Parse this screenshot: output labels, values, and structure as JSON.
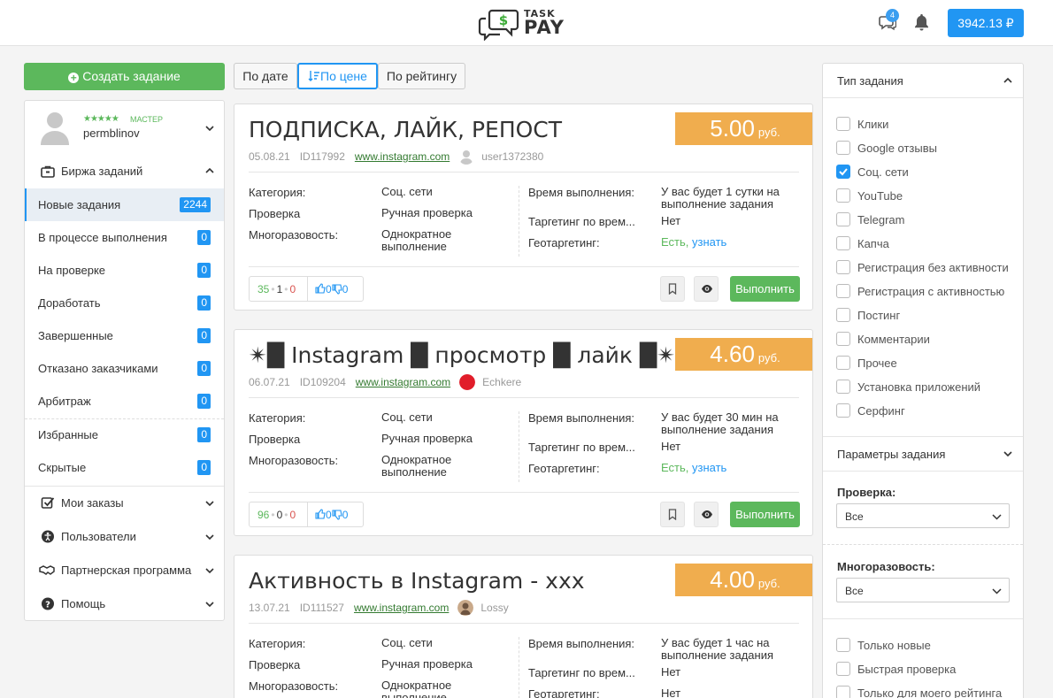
{
  "header": {
    "logo_top": "TASK",
    "logo_bottom": "PAY",
    "messages_count": "4",
    "balance": "3942.13 ₽"
  },
  "sidebar": {
    "create_button": "Создать задание",
    "profile": {
      "rank": "МАСТЕР",
      "username": "permblinov",
      "stars": "★★★★★"
    },
    "exchange_title": "Биржа заданий",
    "items": [
      {
        "label": "Новые задания",
        "count": "2244"
      },
      {
        "label": "В процессе выполнения",
        "count": "0"
      },
      {
        "label": "На проверке",
        "count": "0"
      },
      {
        "label": "Доработать",
        "count": "0"
      },
      {
        "label": "Завершенные",
        "count": "0"
      },
      {
        "label": "Отказано заказчиками",
        "count": "0"
      },
      {
        "label": "Арбитраж",
        "count": "0"
      },
      {
        "label": "Избранные",
        "count": "0"
      },
      {
        "label": "Скрытые",
        "count": "0"
      }
    ],
    "sections": [
      {
        "label": "Мои заказы"
      },
      {
        "label": "Пользователи"
      },
      {
        "label": "Партнерская программа"
      },
      {
        "label": "Помощь"
      }
    ]
  },
  "sort": {
    "by_date": "По дате",
    "by_price": "По цене",
    "by_rating": "По рейтингу"
  },
  "field_labels": {
    "category": "Категория:",
    "check": "Проверка",
    "reusability": "Многоразовость:",
    "time": "Время выполнения:",
    "targeting_time": "Таргетинг по врем...",
    "geo": "Геотаргетинг:",
    "do_button": "Выполнить"
  },
  "tasks": [
    {
      "title": "ПОДПИСКА, ЛАЙК, РЕПОСТ",
      "price": "5.00",
      "currency": "руб.",
      "date": "05.08.21",
      "id": "ID117992",
      "site": "www.instagram.com",
      "user": "user1372380",
      "category": "Соц. сети",
      "check": "Ручная проверка",
      "reusability": "Однократное выполнение",
      "time": "У вас будет 1 сутки на выполнение задания",
      "targeting_time": "Нет",
      "geo": "Есть,",
      "geo_link": "узнать",
      "stat_green": "35",
      "stat_mid": "1",
      "stat_red": "0",
      "likes": "0",
      "dislikes": "0"
    },
    {
      "title": "✴█ Instagram █ просмотр █ лайк █✴",
      "price": "4.60",
      "currency": "руб.",
      "date": "06.07.21",
      "id": "ID109204",
      "site": "www.instagram.com",
      "user": "Echkere",
      "category": "Соц. сети",
      "check": "Ручная проверка",
      "reusability": "Однократное выполнение",
      "time": "У вас будет 30 мин на выполнение задания",
      "targeting_time": "Нет",
      "geo": "Есть,",
      "geo_link": "узнать",
      "stat_green": "96",
      "stat_mid": "0",
      "stat_red": "0",
      "likes": "0",
      "dislikes": "0"
    },
    {
      "title": "Активность в Instagram - xxx",
      "price": "4.00",
      "currency": "руб.",
      "date": "13.07.21",
      "id": "ID111527",
      "site": "www.instagram.com",
      "user": "Lossy",
      "category": "Соц. сети",
      "check": "Ручная проверка",
      "reusability": "Однократное выполнение",
      "time": "У вас будет 1 час на выполнение задания",
      "targeting_time": "Нет",
      "geo": "Нет"
    }
  ],
  "filters": {
    "type_title": "Тип задания",
    "types": [
      {
        "label": "Клики",
        "checked": false
      },
      {
        "label": "Google отзывы",
        "checked": false
      },
      {
        "label": "Соц. сети",
        "checked": true
      },
      {
        "label": "YouTube",
        "checked": false
      },
      {
        "label": "Telegram",
        "checked": false
      },
      {
        "label": "Капча",
        "checked": false
      },
      {
        "label": "Регистрация без активности",
        "checked": false
      },
      {
        "label": "Регистрация с активностью",
        "checked": false
      },
      {
        "label": "Постинг",
        "checked": false
      },
      {
        "label": "Комментарии",
        "checked": false
      },
      {
        "label": "Прочее",
        "checked": false
      },
      {
        "label": "Установка приложений",
        "checked": false
      },
      {
        "label": "Серфинг",
        "checked": false
      }
    ],
    "params_title": "Параметры задания",
    "check_label": "Проверка:",
    "check_value": "Все",
    "reuse_label": "Многоразовость:",
    "reuse_value": "Все",
    "extra": [
      {
        "label": "Только новые",
        "checked": false
      },
      {
        "label": "Быстрая проверка",
        "checked": false
      },
      {
        "label": "Только для моего рейтинга",
        "checked": false
      }
    ]
  }
}
